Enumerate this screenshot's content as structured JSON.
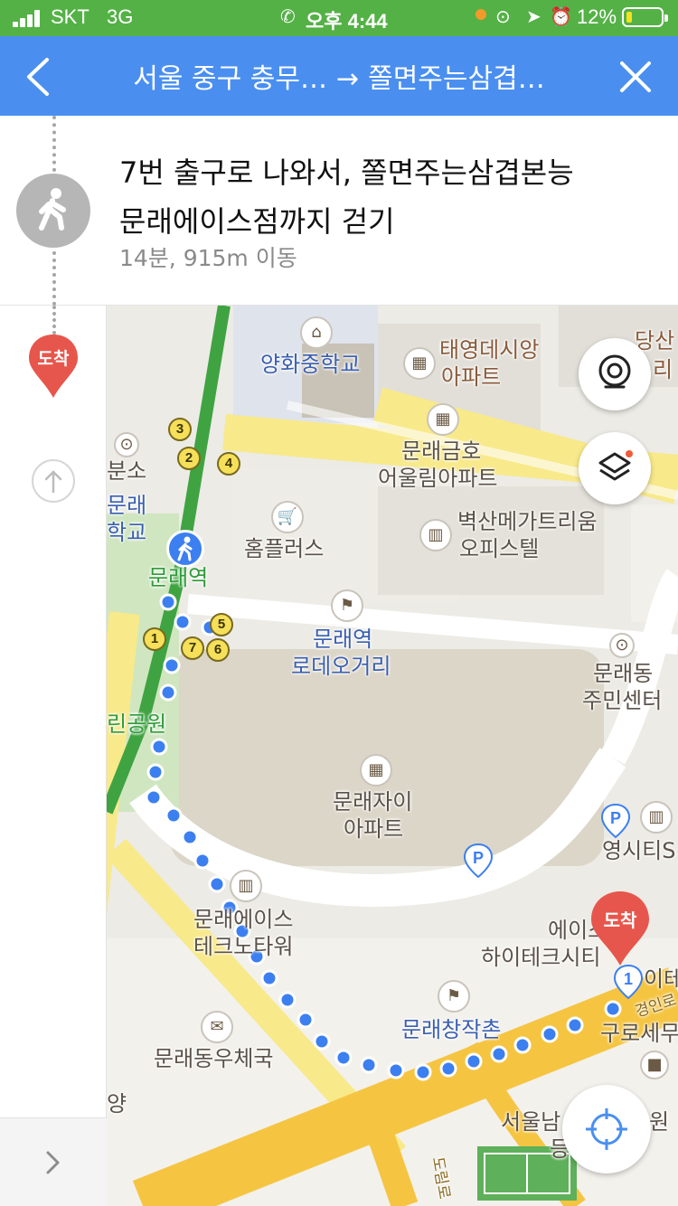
{
  "status_bar": {
    "carrier": "SKT",
    "network": "3G",
    "time": "오후 4:44",
    "battery": "12%",
    "battery_level": 0.12,
    "colors": {
      "background": "#54b146",
      "battery_fill": "#f5e11d"
    }
  },
  "route_header": {
    "origin": "서울 중구 충무…",
    "arrow": "→",
    "destination": "쫄면주는삼겹…",
    "background": "#4a8ff0"
  },
  "instruction": {
    "title_line1": "7번 출구로 나와서, 쫄면주는삼겹본능",
    "title_line2": "문래에이스점까지 걷기",
    "subtitle": "14분, 915m 이동",
    "icon": "walk-icon"
  },
  "left_rail": {
    "arrival_label": "도착",
    "arrival_color": "#e7564c",
    "up_icon": "up-arrow-icon",
    "next_icon": "chevron-right-icon"
  },
  "map": {
    "labels": {
      "school": "양화중학교",
      "taeyoung_1": "태영데시앙",
      "taeyoung_2": "아파트",
      "geumho_1": "문래금호",
      "geumho_2": "어울림아파트",
      "byeoksan_1": "벽산메가트리움",
      "byeoksan_2": "오피스텔",
      "homeplus": "홈플러스",
      "station": "문래역",
      "rodeo_1": "문래역",
      "rodeo_2": "로데오거리",
      "center_1": "문래동",
      "center_2": "주민센터",
      "xi_1": "문래자이",
      "xi_2": "아파트",
      "ace_1": "문래에이스",
      "ace_2": "테크노타워",
      "changjak": "문래창작촌",
      "post": "문래동우체국",
      "ace_hitech_1": "에이스",
      "ace_hitech_2": "하이테크시티",
      "dangsan_1": "당산",
      "dangsan_2": "리",
      "bunso": "분소",
      "mullae_school_1": "문래",
      "mullae_school_2": "학교",
      "park": "린공원",
      "youngcity": "영시티S",
      "ite": "이테",
      "gyeongin": "경인로",
      "guro": "구로세무",
      "seoul_1": "서울남",
      "seoul_2": "원",
      "seoul_3": "등",
      "seoul_frag": "양",
      "doim": "도림로"
    },
    "exits": [
      "1",
      "2",
      "3",
      "4",
      "5",
      "6",
      "7"
    ],
    "destination_pin_label": "도착",
    "destination_marker_number": "1",
    "parking_label": "P",
    "colors": {
      "route": "#3c7ff0",
      "road_yellow": "#f8e98a",
      "road_orange": "#f5c542",
      "subway_green": "#3fa342"
    }
  },
  "controls": {
    "street_view": "street-view-icon",
    "layers": "layers-icon",
    "locate": "locate-icon"
  }
}
